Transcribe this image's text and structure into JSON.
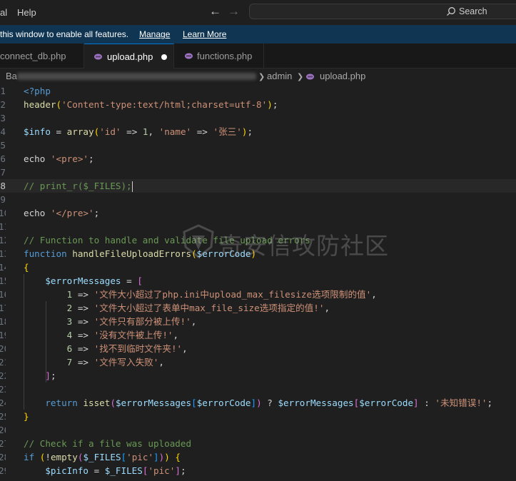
{
  "menu": {
    "item_partial": "al",
    "help": "Help"
  },
  "search": {
    "label": "Search"
  },
  "banner": {
    "text": "this window to enable all features.",
    "manage": "Manage",
    "learn_more": "Learn More",
    "color": "#0f3552"
  },
  "tabs": [
    {
      "label": "connect_db.php",
      "active": false
    },
    {
      "label": "upload.php",
      "active": true,
      "modified": true
    },
    {
      "label": "functions.php",
      "active": false
    }
  ],
  "breadcrumb": {
    "start": "Ba",
    "folder": "admin",
    "file": "upload.php"
  },
  "editor": {
    "current_line": "8",
    "lines": [
      {
        "n": "1",
        "t": [
          [
            "ptag",
            "<?php"
          ]
        ]
      },
      {
        "n": "2",
        "t": [
          [
            "fn",
            "header"
          ],
          [
            "br1",
            "("
          ],
          [
            "str",
            "'Content-type:text/html;charset=utf-8'"
          ],
          [
            "br1",
            ")"
          ],
          [
            "plain",
            ";"
          ]
        ]
      },
      {
        "n": "3",
        "t": []
      },
      {
        "n": "4",
        "t": [
          [
            "var",
            "$info"
          ],
          [
            "plain",
            " = "
          ],
          [
            "fn",
            "array"
          ],
          [
            "br1",
            "("
          ],
          [
            "str",
            "'id'"
          ],
          [
            "plain",
            " => "
          ],
          [
            "num",
            "1"
          ],
          [
            "plain",
            ", "
          ],
          [
            "str",
            "'name'"
          ],
          [
            "plain",
            " => "
          ],
          [
            "str",
            "'张三'"
          ],
          [
            "br1",
            ")"
          ],
          [
            "plain",
            ";"
          ]
        ]
      },
      {
        "n": "5",
        "t": []
      },
      {
        "n": "6",
        "t": [
          [
            "plain",
            "echo "
          ],
          [
            "str",
            "'<pre>'"
          ],
          [
            "plain",
            ";"
          ]
        ]
      },
      {
        "n": "7",
        "t": []
      },
      {
        "n": "8",
        "t": [
          [
            "cmt",
            "// print_r($_FILES);"
          ]
        ]
      },
      {
        "n": "9",
        "t": []
      },
      {
        "n": "10",
        "t": [
          [
            "plain",
            "echo "
          ],
          [
            "str",
            "'</pre>'"
          ],
          [
            "plain",
            ";"
          ]
        ]
      },
      {
        "n": "11",
        "t": []
      },
      {
        "n": "12",
        "t": [
          [
            "cmt",
            "// Function to handle and validate file upload errors"
          ]
        ]
      },
      {
        "n": "13",
        "t": [
          [
            "kw",
            "function "
          ],
          [
            "fn",
            "handleFileUploadErrors"
          ],
          [
            "br1",
            "("
          ],
          [
            "var",
            "$errorCode"
          ],
          [
            "br1",
            ")"
          ]
        ]
      },
      {
        "n": "14",
        "t": [
          [
            "br1",
            "{"
          ]
        ]
      },
      {
        "n": "15",
        "t": [
          [
            "plain",
            "    "
          ],
          [
            "var",
            "$errorMessages"
          ],
          [
            "plain",
            " = "
          ],
          [
            "br2",
            "["
          ]
        ]
      },
      {
        "n": "16",
        "t": [
          [
            "plain",
            "        "
          ],
          [
            "num",
            "1"
          ],
          [
            "plain",
            " => "
          ],
          [
            "str",
            "'文件大小超过了php.ini中upload_max_filesize选项限制的值'"
          ],
          [
            "plain",
            ","
          ]
        ]
      },
      {
        "n": "17",
        "t": [
          [
            "plain",
            "        "
          ],
          [
            "num",
            "2"
          ],
          [
            "plain",
            " => "
          ],
          [
            "str",
            "'文件大小超过了表单中max_file_size选项指定的值!'"
          ],
          [
            "plain",
            ","
          ]
        ]
      },
      {
        "n": "18",
        "t": [
          [
            "plain",
            "        "
          ],
          [
            "num",
            "3"
          ],
          [
            "plain",
            " => "
          ],
          [
            "str",
            "'文件只有部分被上传!'"
          ],
          [
            "plain",
            ","
          ]
        ]
      },
      {
        "n": "19",
        "t": [
          [
            "plain",
            "        "
          ],
          [
            "num",
            "4"
          ],
          [
            "plain",
            " => "
          ],
          [
            "str",
            "'没有文件被上传!'"
          ],
          [
            "plain",
            ","
          ]
        ]
      },
      {
        "n": "20",
        "t": [
          [
            "plain",
            "        "
          ],
          [
            "num",
            "6"
          ],
          [
            "plain",
            " => "
          ],
          [
            "str",
            "'找不到临时文件夹!'"
          ],
          [
            "plain",
            ","
          ]
        ]
      },
      {
        "n": "21",
        "t": [
          [
            "plain",
            "        "
          ],
          [
            "num",
            "7"
          ],
          [
            "plain",
            " => "
          ],
          [
            "str",
            "'文件写入失败'"
          ],
          [
            "plain",
            ","
          ]
        ]
      },
      {
        "n": "22",
        "t": [
          [
            "plain",
            "    "
          ],
          [
            "br2",
            "]"
          ],
          [
            "plain",
            ";"
          ]
        ]
      },
      {
        "n": "23",
        "t": []
      },
      {
        "n": "24",
        "t": [
          [
            "plain",
            "    "
          ],
          [
            "kw",
            "return "
          ],
          [
            "fn",
            "isset"
          ],
          [
            "br2",
            "("
          ],
          [
            "var",
            "$errorMessages"
          ],
          [
            "br3",
            "["
          ],
          [
            "var",
            "$errorCode"
          ],
          [
            "br3",
            "]"
          ],
          [
            "br2",
            ")"
          ],
          [
            "plain",
            " ? "
          ],
          [
            "var",
            "$errorMessages"
          ],
          [
            "br2",
            "["
          ],
          [
            "var",
            "$errorCode"
          ],
          [
            "br2",
            "]"
          ],
          [
            "plain",
            " : "
          ],
          [
            "str",
            "'未知错误!'"
          ],
          [
            "plain",
            ";"
          ]
        ]
      },
      {
        "n": "25",
        "t": [
          [
            "br1",
            "}"
          ]
        ]
      },
      {
        "n": "26",
        "t": []
      },
      {
        "n": "27",
        "t": [
          [
            "cmt",
            "// Check if a file was uploaded"
          ]
        ]
      },
      {
        "n": "28",
        "t": [
          [
            "kw",
            "if "
          ],
          [
            "br1",
            "("
          ],
          [
            "plain",
            "!"
          ],
          [
            "fn",
            "empty"
          ],
          [
            "br2",
            "("
          ],
          [
            "var",
            "$_FILES"
          ],
          [
            "br3",
            "["
          ],
          [
            "str",
            "'pic'"
          ],
          [
            "br3",
            "]"
          ],
          [
            "br2",
            ")"
          ],
          [
            "br1",
            ")"
          ],
          [
            "plain",
            " "
          ],
          [
            "br1",
            "{"
          ]
        ]
      },
      {
        "n": "29",
        "t": [
          [
            "plain",
            "    "
          ],
          [
            "var",
            "$picInfo"
          ],
          [
            "plain",
            " = "
          ],
          [
            "var",
            "$_FILES"
          ],
          [
            "br2",
            "["
          ],
          [
            "str",
            "'pic'"
          ],
          [
            "br2",
            "]"
          ],
          [
            "plain",
            ";"
          ]
        ]
      }
    ]
  },
  "watermark": {
    "text": "奇安信攻防社区"
  },
  "colors": {
    "background": "#1f1f1f",
    "keyword": "#569cd6",
    "function": "#dcdcaa",
    "variable": "#9cdcfe",
    "string": "#ce9178",
    "number": "#b5cea8",
    "comment": "#6a9955",
    "php_icon": "#a074c4"
  },
  "icons": [
    "back-arrow-icon",
    "forward-arrow-icon",
    "search-icon",
    "php-file-icon",
    "modified-dot-icon",
    "chevron-right-icon",
    "watermark-logo-icon"
  ]
}
